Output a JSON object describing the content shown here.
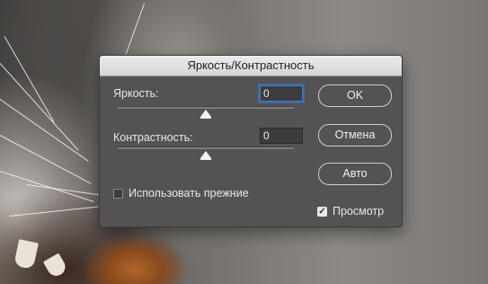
{
  "dialog": {
    "title": "Яркость/Контрастность",
    "brightness": {
      "label": "Яркость:",
      "value": "0",
      "slider_position": 0.5
    },
    "contrast": {
      "label": "Контрастность:",
      "value": "0",
      "slider_position": 0.5
    },
    "buttons": {
      "ok": "OK",
      "cancel": "Отмена",
      "auto": "Авто"
    },
    "use_legacy": {
      "label": "Использовать прежние",
      "checked": false
    },
    "preview": {
      "label": "Просмотр",
      "checked": true
    }
  },
  "colors": {
    "dialog_bg": "#535353",
    "titlebar_bg": "#dcdcdc",
    "focus_ring": "#3d7bd9"
  }
}
